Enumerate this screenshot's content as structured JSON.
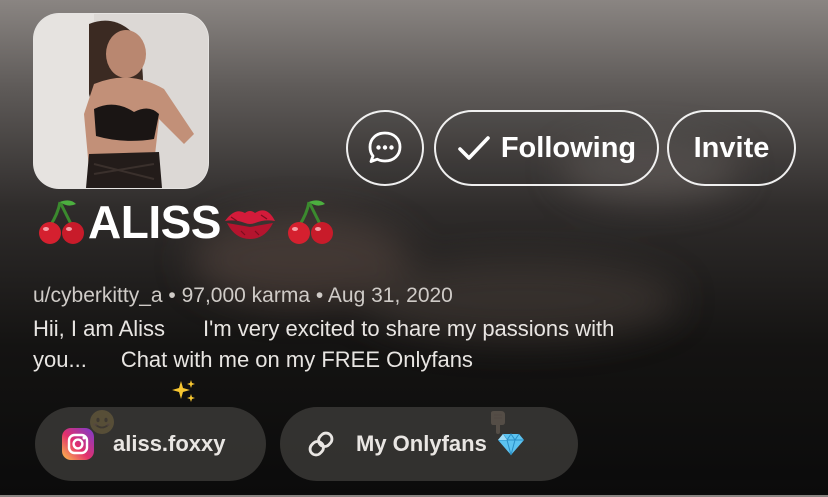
{
  "profile": {
    "display_name": "ALISS",
    "username": "u/cyberkitty_a",
    "separator": "•",
    "karma": "97,000 karma",
    "joined": "Aug 31, 2020",
    "bio_line1_a": "Hii, I am Aliss",
    "bio_line1_b": "I'm very excited to share my passions with",
    "bio_line2_a": "you...",
    "bio_line2_b": "Chat with me on my FREE Onlyfans"
  },
  "actions": {
    "following_label": "Following",
    "invite_label": "Invite"
  },
  "links": {
    "instagram_label": "aliss.foxxy",
    "onlyfans_label": "My Onlyfans"
  },
  "icons": {
    "chat": "chat-bubble-icon",
    "check": "check-icon",
    "cherry": "cherry-emoji",
    "kiss": "kiss-mark-emoji",
    "sparkles": "sparkles-emoji",
    "smile": "smile-emoji",
    "point_down": "point-down-emoji",
    "instagram": "instagram-icon",
    "link": "link-icon",
    "diamond": "gem-emoji"
  },
  "colors": {
    "accent": "#ffffff",
    "pill_bg": "#3a3836",
    "meta_text": "#cfcbc7"
  }
}
